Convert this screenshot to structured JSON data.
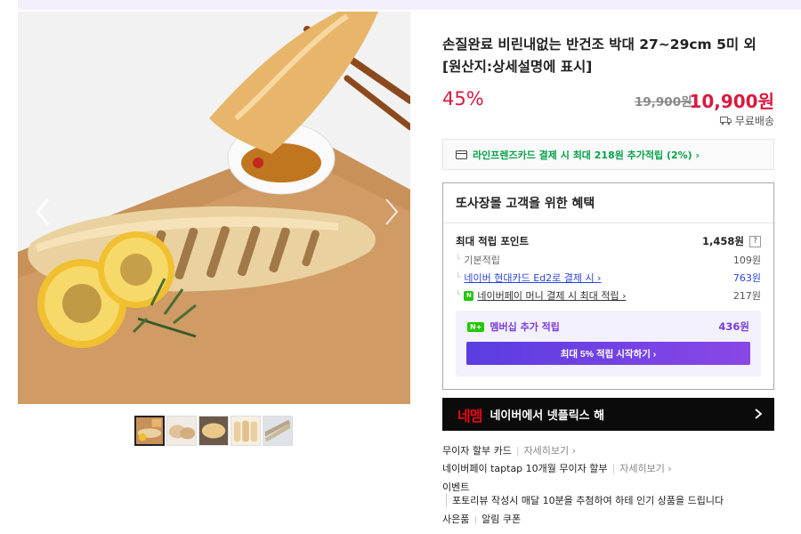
{
  "gallery": {
    "thumbnail_count": 5,
    "active_thumbnail": 1
  },
  "product": {
    "title": "손질완료 비린내없는 반건조 박대 27~29cm 5미 외 [원산지:상세설명에 표시]",
    "discount": "45%",
    "original_price": "19,900원",
    "sale_price": "10,900원",
    "shipping": "무료배송"
  },
  "card_promo": {
    "text": "라인프렌즈카드 결제 시 최대 218원 추가적립 (2%) ›"
  },
  "benefits": {
    "title": "또사장몰 고객을 위한 혜택",
    "max_points_label": "최대 적립 포인트",
    "max_points_value": "1,458원",
    "help": "?",
    "rows": [
      {
        "label": "기본적립",
        "value": "109원"
      },
      {
        "label": "네이버 현대카드 Ed2로 결제 시 ›",
        "value": "763원"
      },
      {
        "label": "네이버페이 머니 결제 시 최대 적립 ›",
        "value": "217원"
      }
    ],
    "membership": {
      "badge": "N+",
      "label": "멤버십 추가 적립",
      "value": "436원",
      "button": "최대 5% 적립 시작하기 ›"
    }
  },
  "netflix": {
    "logo": "네멤",
    "text": "네이버에서 넷플릭스 해"
  },
  "info": {
    "installment": "무이자 할부 카드",
    "installment_more": "자세히보기 ›",
    "taptap": "네이버페이 taptap 10개월 무이자 할부",
    "taptap_more": "자세히보기 ›",
    "event_label": "이벤트",
    "event_desc": "포토리뷰 작성시 매달 10분을 추첨하여 하테 인기 상품을 드립니다",
    "gift": "사은품",
    "gift_value": "알림 쿠폰"
  },
  "colors": {
    "accent_red": "#d8193f",
    "membership_purple": "#7b3cdc",
    "naver_green": "#1ec800"
  }
}
